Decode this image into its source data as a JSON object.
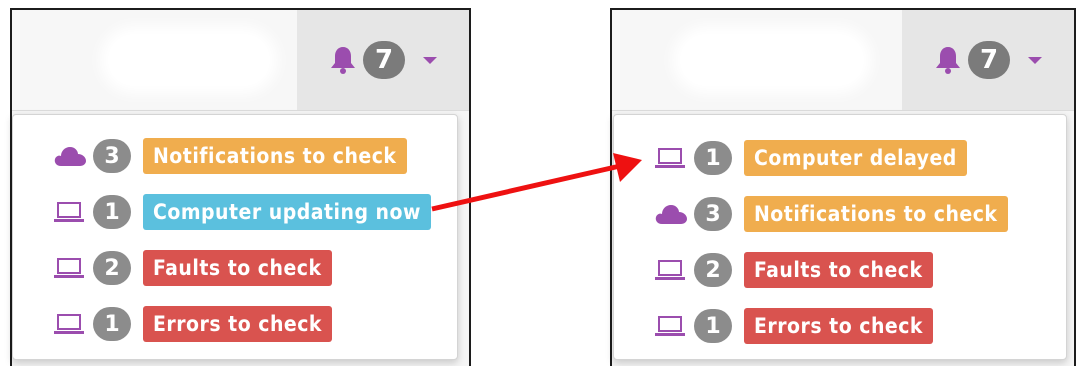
{
  "colors": {
    "accent_purple": "#9b4dae",
    "badge_gray": "#8c8c8c",
    "warning_orange": "#f0ad4e",
    "info_blue": "#5bc0de",
    "danger_red": "#d9534f",
    "arrow_red": "#ee1111"
  },
  "left_panel": {
    "notification_count": "7",
    "items": [
      {
        "icon": "cloud-icon",
        "count": "3",
        "label": "Notifications to check",
        "status": "warning"
      },
      {
        "icon": "laptop-icon",
        "count": "1",
        "label": "Computer updating now",
        "status": "info"
      },
      {
        "icon": "laptop-icon",
        "count": "2",
        "label": "Faults to check",
        "status": "danger"
      },
      {
        "icon": "laptop-icon",
        "count": "1",
        "label": "Errors to check",
        "status": "danger"
      }
    ]
  },
  "right_panel": {
    "notification_count": "7",
    "items": [
      {
        "icon": "laptop-icon",
        "count": "1",
        "label": "Computer delayed",
        "status": "warning"
      },
      {
        "icon": "cloud-icon",
        "count": "3",
        "label": "Notifications to check",
        "status": "warning"
      },
      {
        "icon": "laptop-icon",
        "count": "2",
        "label": "Faults to check",
        "status": "danger"
      },
      {
        "icon": "laptop-icon",
        "count": "1",
        "label": "Errors to check",
        "status": "danger"
      }
    ]
  }
}
